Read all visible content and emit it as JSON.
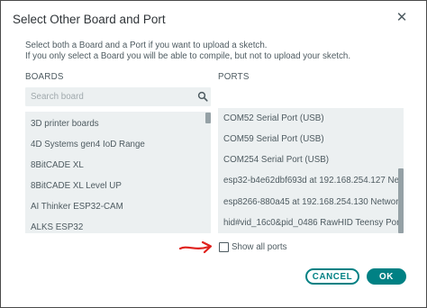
{
  "dialog": {
    "title": "Select Other Board and Port",
    "description_line1": "Select both a Board and a Port if you want to upload a sketch.",
    "description_line2": "If you only select a Board you will be able to compile, but not to upload your sketch."
  },
  "boards": {
    "label": "BOARDS",
    "search_placeholder": "Search board",
    "items": [
      "3D printer boards",
      "4D Systems gen4 IoD Range",
      "8BitCADE XL",
      "8BitCADE XL Level UP",
      "AI Thinker ESP32-CAM",
      "ALKS ESP32"
    ]
  },
  "ports": {
    "label": "PORTS",
    "items": [
      "COM52 Serial Port (USB)",
      "COM59 Serial Port (USB)",
      "COM254 Serial Port (USB)",
      "esp32-b4e62dbf693d at 192.168.254.127 Netw...",
      "esp8266-880a45 at 192.168.254.130 Network ...",
      "hid#vid_16c0&pid_0486 RawHID Teensy Ports"
    ]
  },
  "show_all_ports": {
    "label": "Show all ports",
    "checked": false
  },
  "buttons": {
    "cancel": "CANCEL",
    "ok": "OK"
  },
  "colors": {
    "accent": "#008184",
    "list_bg": "#ecf0f1",
    "annotation_arrow": "#e0201c"
  },
  "icons": {
    "close": "close-icon",
    "search": "search-icon"
  }
}
